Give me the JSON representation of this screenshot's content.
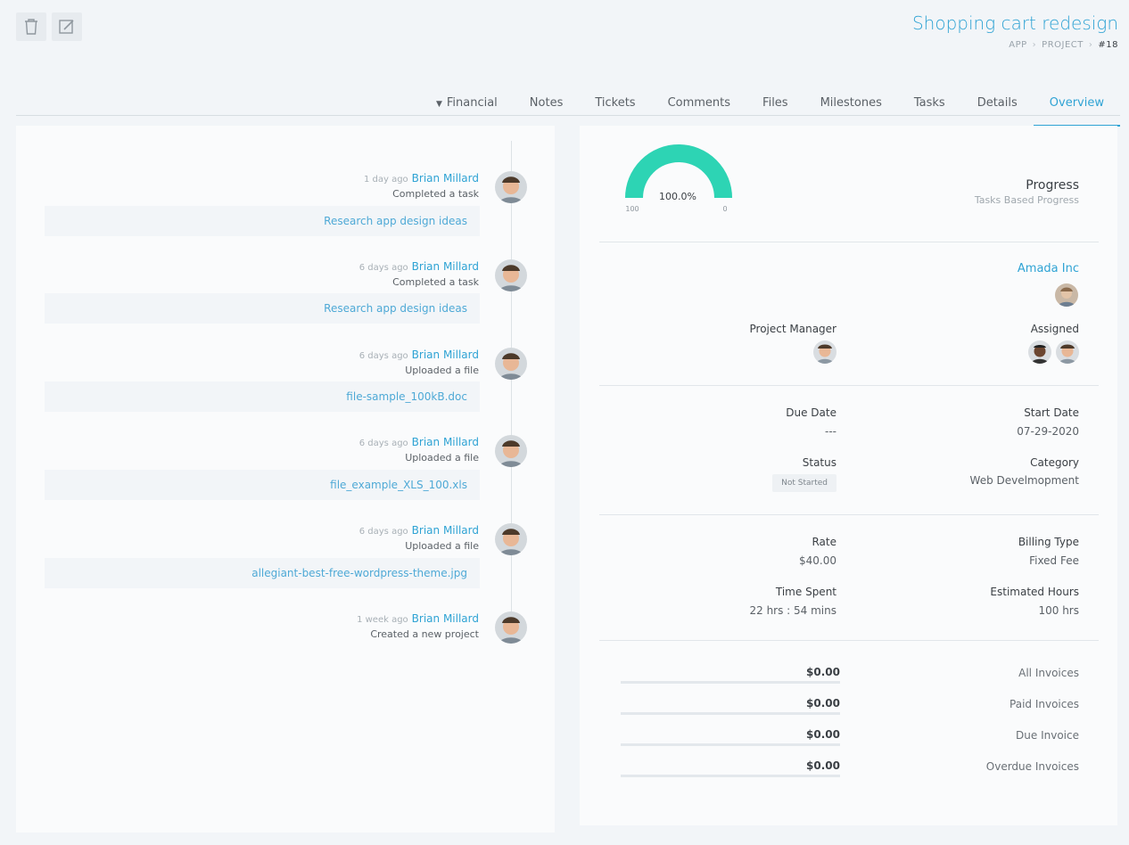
{
  "header": {
    "title": "Shopping cart redesign",
    "breadcrumb": [
      "APP",
      "PROJECT",
      "#18"
    ]
  },
  "toolbar": {
    "edit_icon": "edit-icon",
    "delete_icon": "trash-icon"
  },
  "tabs": [
    {
      "label": "Overview",
      "active": true
    },
    {
      "label": "Details"
    },
    {
      "label": "Tasks"
    },
    {
      "label": "Milestones"
    },
    {
      "label": "Files"
    },
    {
      "label": "Comments"
    },
    {
      "label": "Tickets"
    },
    {
      "label": "Notes"
    },
    {
      "label": "Financial",
      "dropdown": true
    }
  ],
  "progress": {
    "title": "Progress",
    "subtitle": "Tasks Based Progress",
    "percent_text": "100.0%",
    "fraction": 1.0,
    "min_label": "0",
    "max_label": "100",
    "color": "#2dd4b4"
  },
  "client": {
    "name": "Amada Inc"
  },
  "assigned": {
    "label": "Assigned"
  },
  "manager": {
    "label": "Project Manager"
  },
  "dates": {
    "start_label": "Start Date",
    "start_value": "07-29-2020",
    "due_label": "Due Date",
    "due_value": "---",
    "category_label": "Category",
    "category_value": "Web Develmopment",
    "status_label": "Status",
    "status_value": "Not Started"
  },
  "billing": {
    "type_label": "Billing Type",
    "type_value": "Fixed Fee",
    "rate_label": "Rate",
    "rate_value": "$40.00",
    "est_label": "Estimated Hours",
    "est_value": "100 hrs",
    "spent_label": "Time Spent",
    "spent_value": "22 hrs : 54 mins"
  },
  "invoices": [
    {
      "label": "All Invoices",
      "value": "$0.00"
    },
    {
      "label": "Paid Invoices",
      "value": "$0.00"
    },
    {
      "label": "Due Invoice",
      "value": "$0.00"
    },
    {
      "label": "Overdue Invoices",
      "value": "$0.00"
    }
  ],
  "activity": [
    {
      "user": "Brian Millard",
      "time": "1 day ago",
      "action": "Completed a task",
      "item": "Research app design ideas"
    },
    {
      "user": "Brian Millard",
      "time": "6 days ago",
      "action": "Completed a task",
      "item": "Research app design ideas"
    },
    {
      "user": "Brian Millard",
      "time": "6 days ago",
      "action": "Uploaded a file",
      "item": "file-sample_100kB.doc"
    },
    {
      "user": "Brian Millard",
      "time": "6 days ago",
      "action": "Uploaded a file",
      "item": "file_example_XLS_100.xls"
    },
    {
      "user": "Brian Millard",
      "time": "6 days ago",
      "action": "Uploaded a file",
      "item": "allegiant-best-free-wordpress-theme.jpg"
    },
    {
      "user": "Brian Millard",
      "time": "1 week ago",
      "action": "Created a new project"
    }
  ]
}
